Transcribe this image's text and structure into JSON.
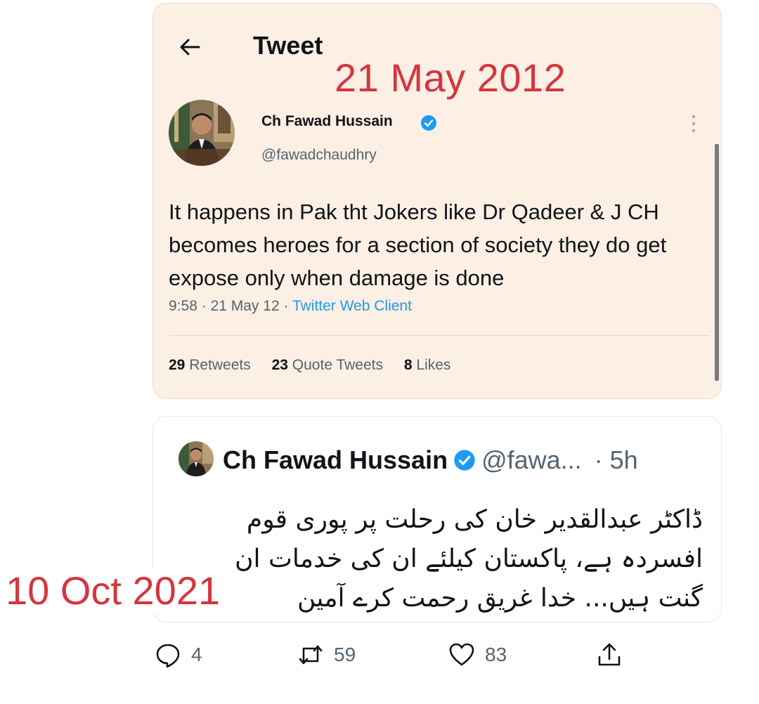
{
  "overlay": {
    "date_top": "21 May 2012",
    "date_bottom": "10 Oct 2021"
  },
  "tweet_detail": {
    "header_title": "Tweet",
    "back_icon": "arrow-left-icon",
    "author_name": "Ch Fawad Hussain",
    "author_handle": "@fawadchaudhry",
    "verified_icon": "verified-badge-icon",
    "more_icon": "more-vertical-icon",
    "text": "It happens in Pak tht Jokers like Dr Qadeer & J CH becomes heroes for a section of society they do get expose only when damage is done",
    "time": "9:58",
    "date": "21 May 12",
    "separator": "·",
    "client": "Twitter Web Client",
    "stats": {
      "retweets_count": "29",
      "retweets_label": "Retweets",
      "quotes_count": "23",
      "quotes_label": "Quote Tweets",
      "likes_count": "8",
      "likes_label": "Likes"
    }
  },
  "tweet_recent": {
    "author_name": "Ch Fawad Hussain",
    "author_handle": "@fawa...",
    "time": "· 5h",
    "text_lines": [
      "ڈاکٹر عبدالقدیر خان کی رحلت پر پوری قوم",
      "افسردہ ہے، پاکستان کیلئے ان کی خدمات ان",
      "گنت ہیں... خدا غریق رحمت کرے آمین"
    ],
    "actions": {
      "reply_icon": "reply-icon",
      "reply_count": "4",
      "retweet_icon": "retweet-icon",
      "retweet_count": "59",
      "like_icon": "heart-icon",
      "like_count": "83",
      "share_icon": "share-icon"
    }
  },
  "colors": {
    "card_bg": "#fcefe3",
    "overlay_red": "#d3363f",
    "link_blue": "#1d9bf0",
    "muted_text": "#536471"
  }
}
